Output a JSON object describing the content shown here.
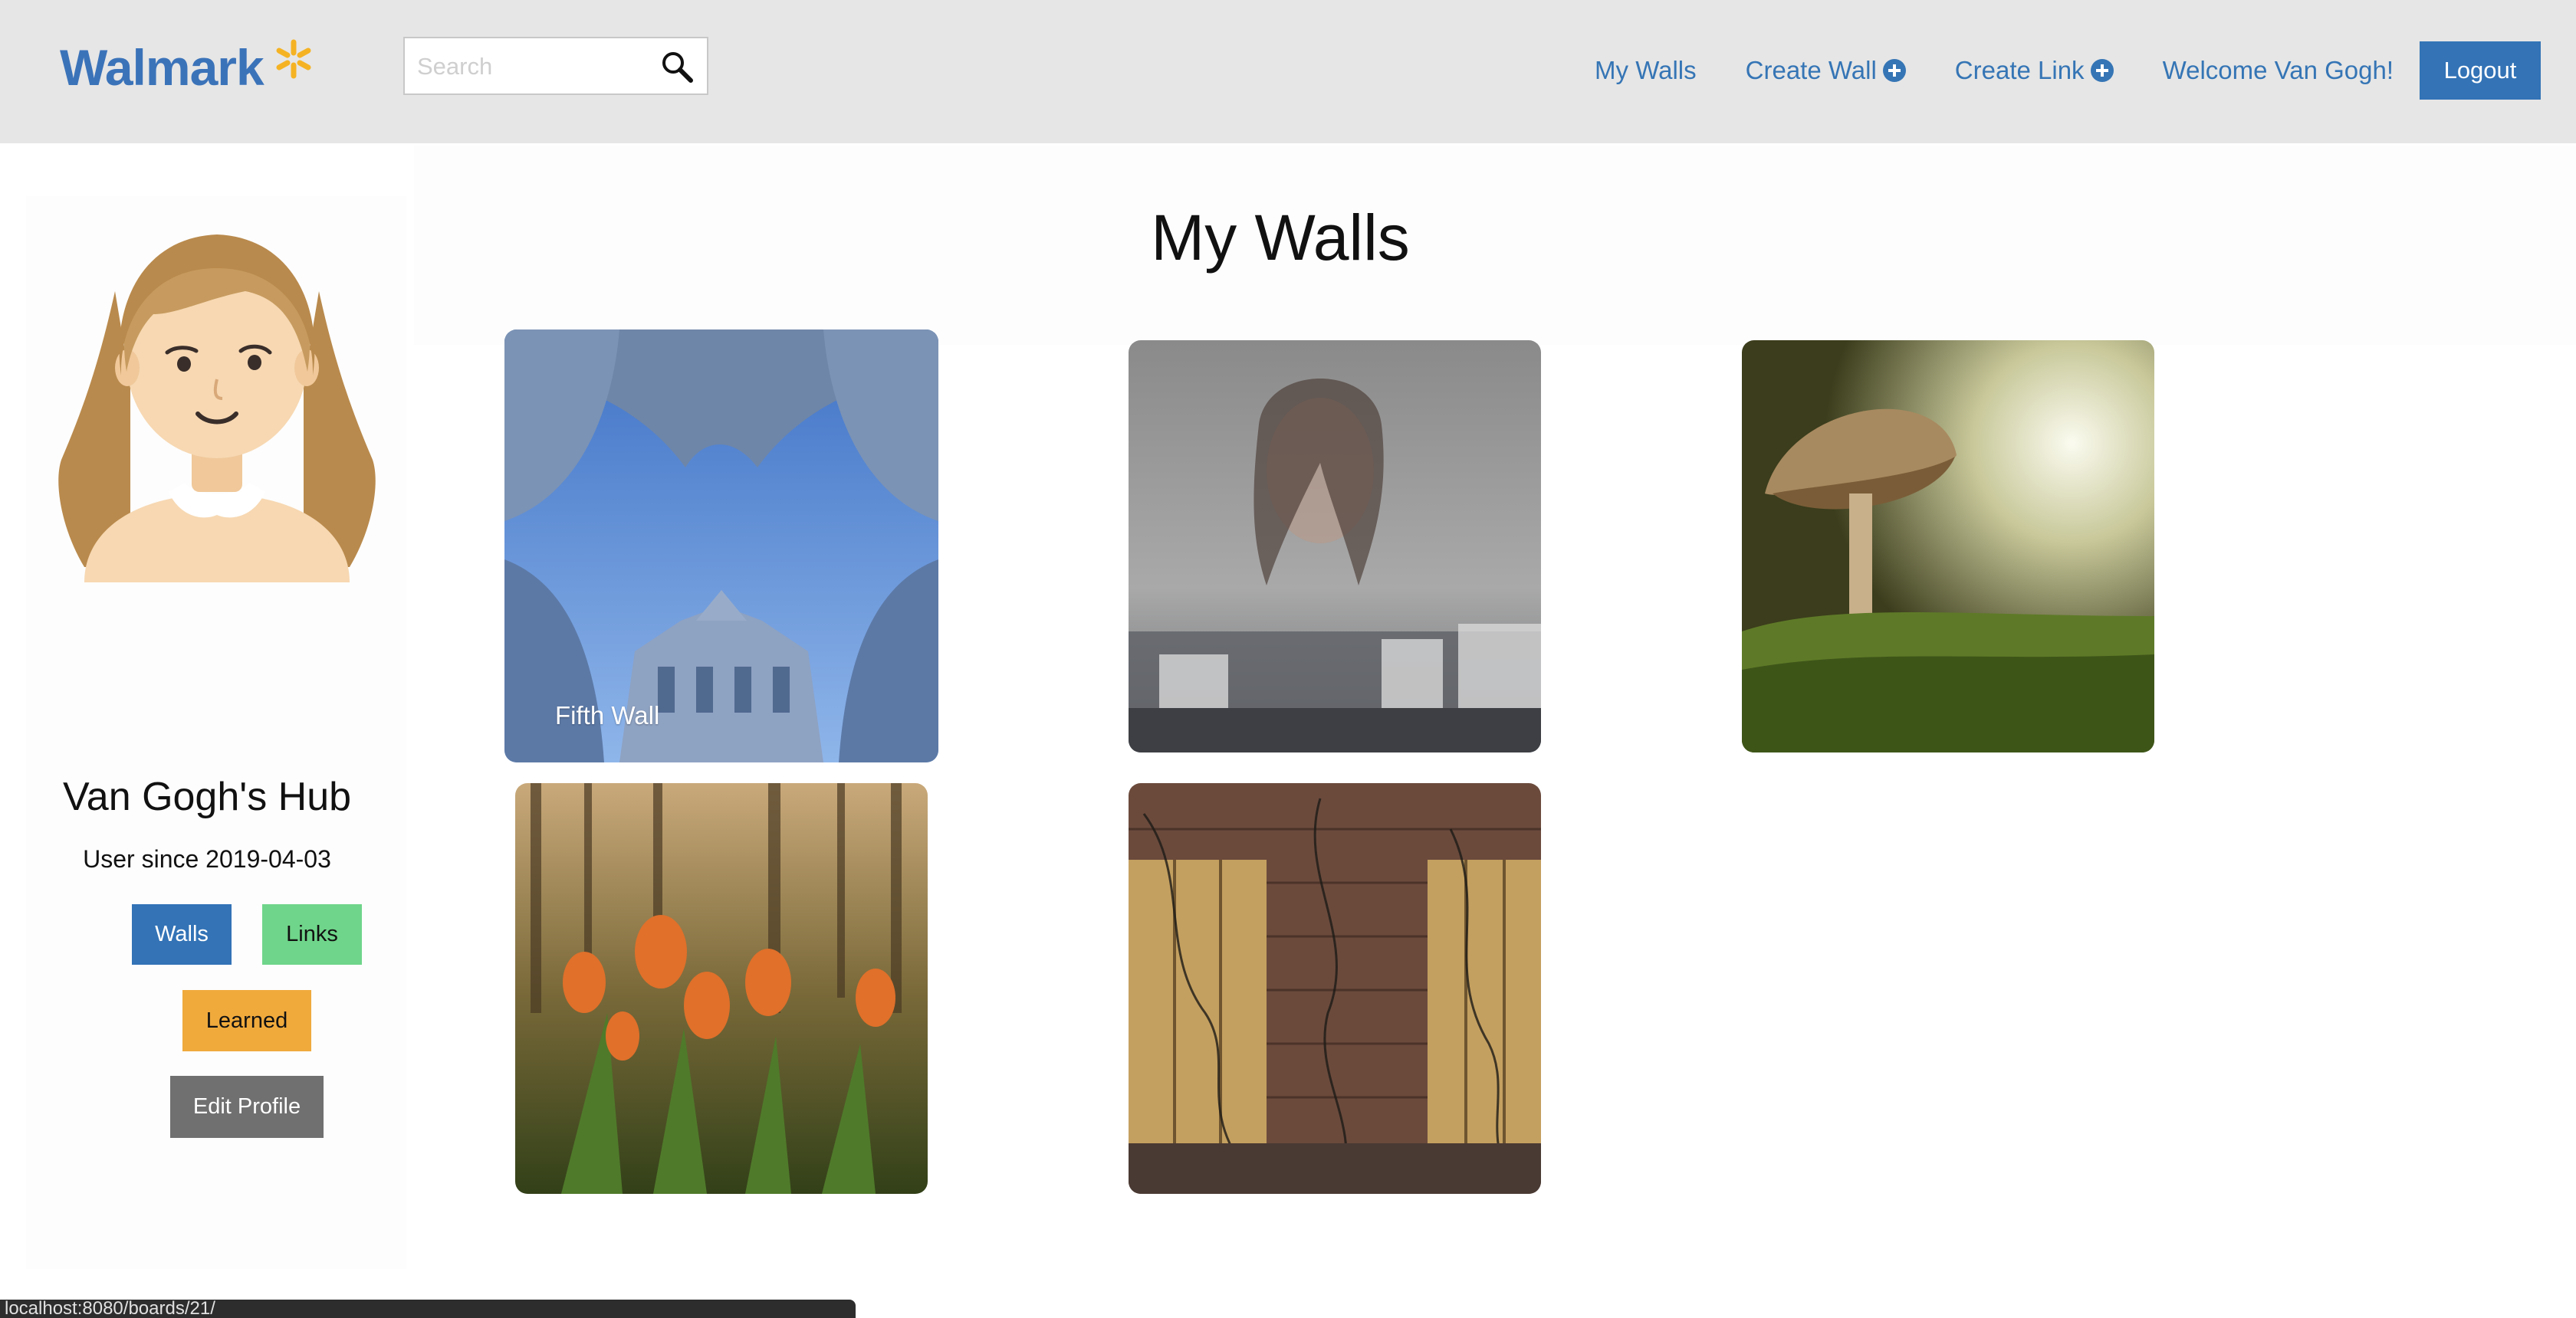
{
  "navbar": {
    "brand": "Walmark",
    "search": {
      "placeholder": "Search"
    },
    "links": {
      "my_walls": "My Walls",
      "create_wall": "Create Wall",
      "create_link": "Create Link"
    },
    "welcome": "Welcome Van Gogh!",
    "logout": "Logout",
    "colors": {
      "background": "#e6e6e6",
      "link": "#3575b5",
      "spark": "#f5b324"
    }
  },
  "sidebar": {
    "hub_title": "Van Gogh's Hub",
    "user_since": "User since 2019-04-03",
    "buttons": {
      "walls": "Walls",
      "links": "Links",
      "learned": "Learned",
      "edit_profile": "Edit Profile"
    },
    "colors": {
      "walls": "#3373b6",
      "links": "#6fd58a",
      "learned": "#f0aa3c",
      "edit_profile": "#707070"
    }
  },
  "main": {
    "title": "My Walls",
    "walls": [
      {
        "caption": "Fifth Wall",
        "image": "baroque-courtyard-sky"
      },
      {
        "caption": "",
        "image": "woman-behind-rainy-window"
      },
      {
        "caption": "",
        "image": "mushroom-macro"
      },
      {
        "caption": "",
        "image": "orange-tulips-forest"
      },
      {
        "caption": "",
        "image": "brick-wall-shutters-ivy"
      }
    ]
  },
  "statusbar": {
    "url": "localhost:8080/boards/21/"
  }
}
